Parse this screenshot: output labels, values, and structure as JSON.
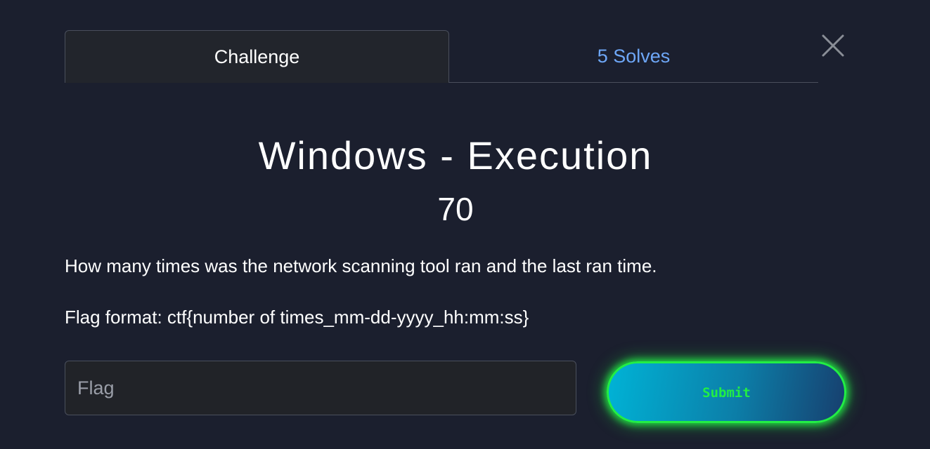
{
  "tabs": {
    "challenge": "Challenge",
    "solves": "5 Solves"
  },
  "challenge": {
    "name": "Windows - Execution",
    "value": "70",
    "description": [
      "How many times was the network scanning tool ran and the last ran time.",
      "Flag format: ctf{number of times_mm-dd-yyyy_hh:mm:ss}"
    ]
  },
  "form": {
    "flag_placeholder": "Flag",
    "flag_value": "",
    "submit_label": "Submit"
  },
  "icons": {
    "close": "close-icon"
  },
  "colors": {
    "background": "#1b1f2e",
    "active_tab": "#22252c",
    "link": "#6ea7f7",
    "submit_glow": "#22ee44",
    "submit_gradient_start": "#00b3d6",
    "submit_gradient_end": "#173f6e"
  }
}
